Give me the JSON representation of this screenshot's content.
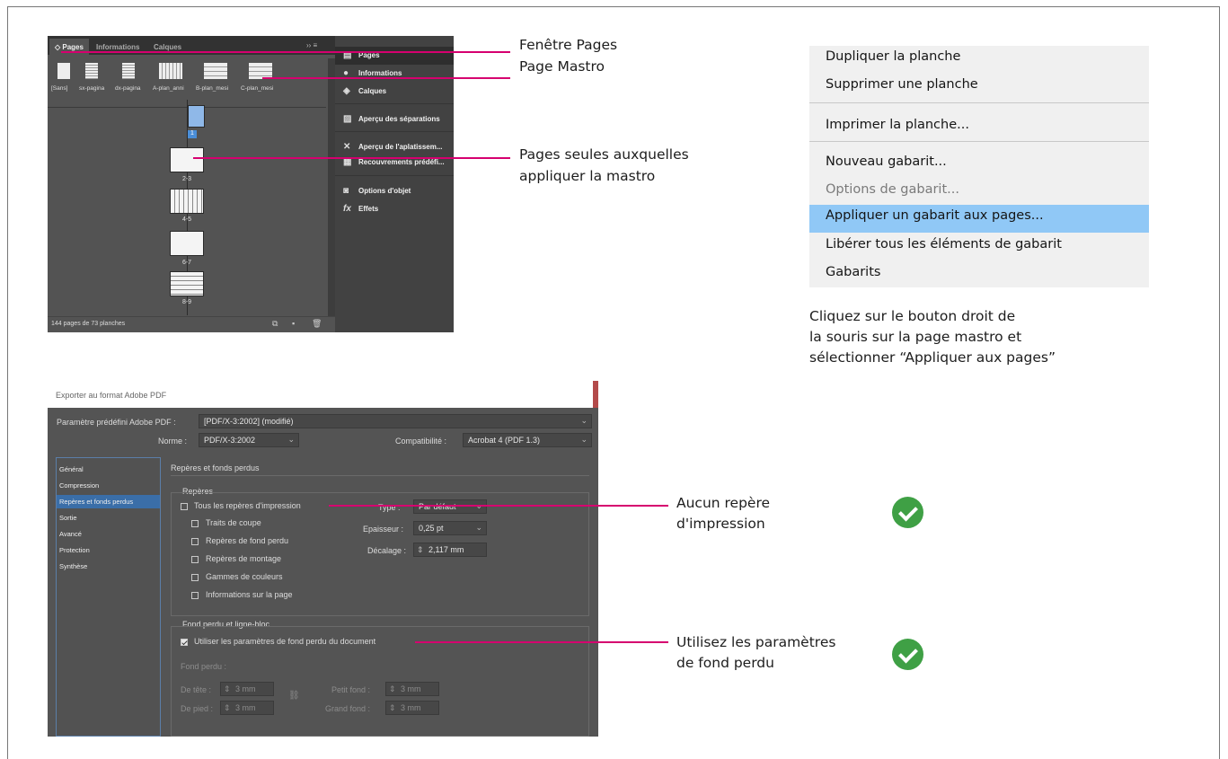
{
  "annotations": {
    "fenetre_pages": "Fenêtre Pages",
    "page_mastro": "Page Mastro",
    "pages_seules_1": "Pages seules auxquelles",
    "pages_seules_2": "appliquer la mastro",
    "cliquez_1": "Cliquez sur le bouton droit de",
    "cliquez_2": "la souris sur la page mastro et",
    "cliquez_3": "sélectionner “Appliquer aux pages”",
    "aucun_1": "Aucun repère",
    "aucun_2": "d'impression",
    "utilisez_1": "Utilisez les paramètres",
    "utilisez_2": "de fond perdu",
    "accent_color": "#d6006f",
    "check_color": "#3fa045"
  },
  "pages_panel": {
    "tabs": [
      "◇ Pages",
      "Informations",
      "Calques"
    ],
    "masters": [
      "[Sans]",
      "sx-pagina",
      "dx-pagina",
      "A-plan_anni",
      "B-plan_mesi",
      "C-plan_mesi"
    ],
    "page_labels": [
      "1",
      "2-3",
      "4-5",
      "6-7",
      "8-9"
    ],
    "footer": "144 pages de 73 planches"
  },
  "dock": {
    "items": [
      "Pages",
      "Informations",
      "Calques",
      "Aperçu des séparations",
      "Aperçu de l'aplatissem...",
      "Recouvrements prédéfi...",
      "Options d'objet",
      "Effets"
    ]
  },
  "context_menu": {
    "items": [
      "Dupliquer la planche",
      "Supprimer une planche",
      "Imprimer la planche...",
      "Nouveau gabarit...",
      "Options de gabarit...",
      "Appliquer un gabarit aux pages...",
      "Libérer tous les éléments de gabarit",
      "Gabarits"
    ]
  },
  "export_dialog": {
    "title": "Exporter au format Adobe PDF",
    "preset_label": "Paramètre prédéfini Adobe PDF :",
    "preset_value": "[PDF/X-3:2002] (modifié)",
    "norme_label": "Norme :",
    "norme_value": "PDF/X-3:2002",
    "compat_label": "Compatibilité :",
    "compat_value": "Acrobat 4 (PDF 1.3)",
    "sections": [
      "Général",
      "Compression",
      "Repères et fonds perdus",
      "Sortie",
      "Avancé",
      "Protection",
      "Synthèse"
    ],
    "heading": "Repères et fonds perdus",
    "reperes_group": "Repères",
    "all_marks": "Tous les repères d'impression",
    "marks": [
      "Traits de coupe",
      "Repères de fond perdu",
      "Repères de montage",
      "Gammes de couleurs",
      "Informations sur la page"
    ],
    "type_label": "Type :",
    "type_value": "Par défaut",
    "epaisseur_label": "Epaisseur :",
    "epaisseur_value": "0,25 pt",
    "decalage_label": "Décalage :",
    "decalage_value": "2,117 mm",
    "bleed_group": "Fond perdu et ligne-bloc",
    "use_doc_bleed": "Utiliser les paramètres de fond perdu du document",
    "fond_perdu": "Fond perdu :",
    "de_tete": "De tête :",
    "de_pied": "De pied :",
    "petit_fond": "Petit fond :",
    "grand_fond": "Grand fond :",
    "bleed_value": "3 mm"
  }
}
